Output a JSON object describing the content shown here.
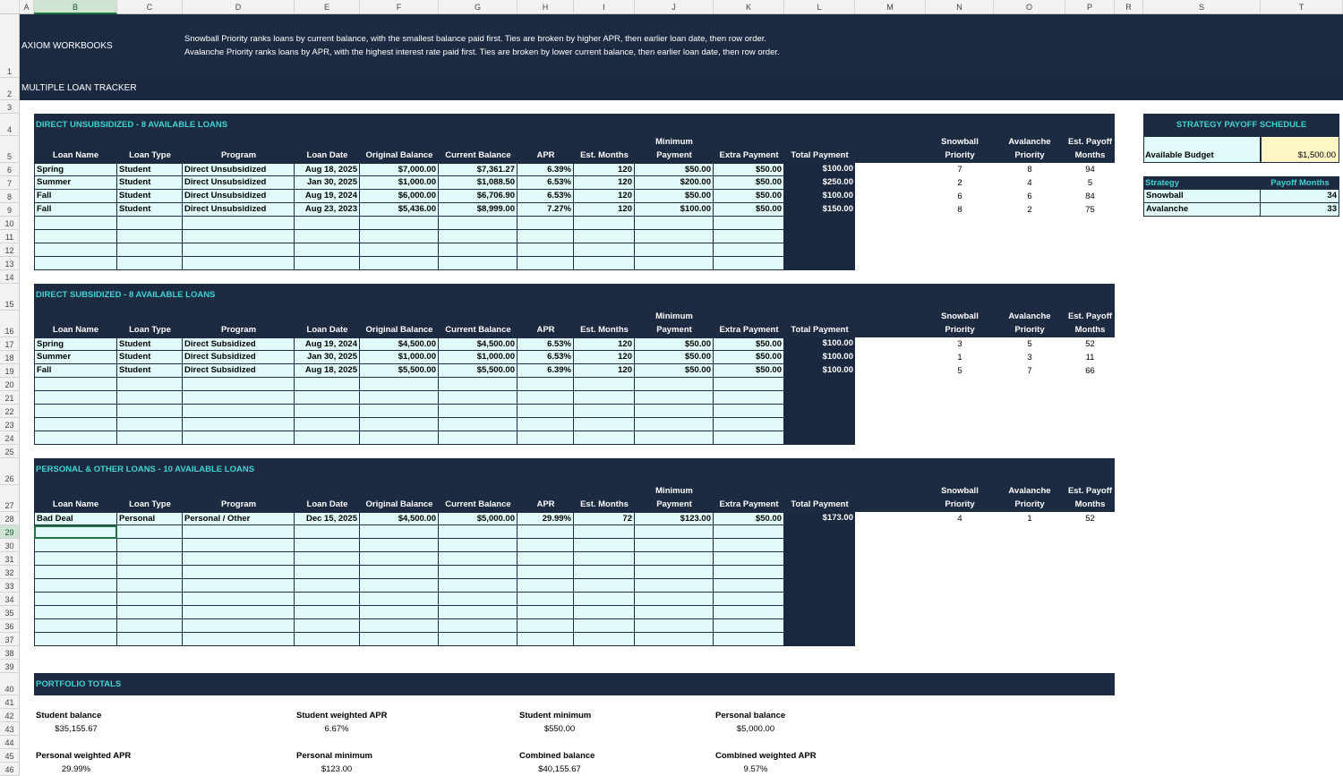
{
  "columns": [
    "A",
    "B",
    "C",
    "D",
    "E",
    "F",
    "G",
    "H",
    "I",
    "J",
    "K",
    "L",
    "M",
    "N",
    "O",
    "P",
    "R",
    "S",
    "T"
  ],
  "rows": [
    "1",
    "2",
    "3",
    "4",
    "5",
    "6",
    "7",
    "8",
    "9",
    "10",
    "11",
    "12",
    "13",
    "14",
    "15",
    "16",
    "17",
    "18",
    "19",
    "20",
    "21",
    "22",
    "23",
    "24",
    "25",
    "26",
    "27",
    "28",
    "29",
    "30",
    "31",
    "32",
    "33",
    "34",
    "35",
    "36",
    "37",
    "38",
    "39",
    "40",
    "41",
    "42",
    "43",
    "44",
    "45",
    "46"
  ],
  "header": {
    "brand": "AXIOM WORKBOOKS",
    "note1": "Snowball Priority ranks loans by current balance, with the smallest balance paid first. Ties are broken by higher APR, then earlier loan date, then row order.",
    "note2": "Avalanche Priority ranks loans by APR, with the highest interest rate paid first. Ties are broken by lower current balance, then earlier loan date, then row order.",
    "title": "MULTIPLE LOAN TRACKER"
  },
  "table_headers": {
    "loan_name": "Loan Name",
    "loan_type": "Loan Type",
    "program": "Program",
    "loan_date": "Loan Date",
    "original_balance": "Original Balance",
    "current_balance": "Current Balance",
    "apr": "APR",
    "est_months": "Est. Months",
    "min_payment_1": "Minimum",
    "min_payment_2": "Payment",
    "extra_payment": "Extra Payment",
    "total_payment": "Total Payment",
    "snowball_1": "Snowball",
    "snowball_2": "Priority",
    "avalanche_1": "Avalanche",
    "avalanche_2": "Priority",
    "payoff_1": "Est. Payoff",
    "payoff_2": "Months"
  },
  "sections": [
    {
      "title": "DIRECT UNSUBSIDIZED - 8 AVAILABLE LOANS",
      "rows": [
        {
          "name": "Spring",
          "type": "Student",
          "program": "Direct Unsubsidized",
          "date": "Aug 18, 2025",
          "orig": "$7,000.00",
          "curr": "$7,361.27",
          "apr": "6.39%",
          "months": "120",
          "min": "$50.00",
          "extra": "$50.00",
          "total": "$100.00",
          "snow": "7",
          "aval": "8",
          "payoff": "94"
        },
        {
          "name": "Summer",
          "type": "Student",
          "program": "Direct Unsubsidized",
          "date": "Jan 30, 2025",
          "orig": "$1,000.00",
          "curr": "$1,088.50",
          "apr": "6.53%",
          "months": "120",
          "min": "$200.00",
          "extra": "$50.00",
          "total": "$250.00",
          "snow": "2",
          "aval": "4",
          "payoff": "5"
        },
        {
          "name": "Fall",
          "type": "Student",
          "program": "Direct Unsubsidized",
          "date": "Aug 19, 2024",
          "orig": "$6,000.00",
          "curr": "$6,706.90",
          "apr": "6.53%",
          "months": "120",
          "min": "$50.00",
          "extra": "$50.00",
          "total": "$100.00",
          "snow": "6",
          "aval": "6",
          "payoff": "84"
        },
        {
          "name": "Fall",
          "type": "Student",
          "program": "Direct Unsubsidized",
          "date": "Aug 23, 2023",
          "orig": "$5,436.00",
          "curr": "$8,999.00",
          "apr": "7.27%",
          "months": "120",
          "min": "$100.00",
          "extra": "$50.00",
          "total": "$150.00",
          "snow": "8",
          "aval": "2",
          "payoff": "75"
        }
      ]
    },
    {
      "title": "DIRECT SUBSIDIZED - 8 AVAILABLE LOANS",
      "rows": [
        {
          "name": "Spring",
          "type": "Student",
          "program": "Direct Subsidized",
          "date": "Aug 19, 2024",
          "orig": "$4,500.00",
          "curr": "$4,500.00",
          "apr": "6.53%",
          "months": "120",
          "min": "$50.00",
          "extra": "$50.00",
          "total": "$100.00",
          "snow": "3",
          "aval": "5",
          "payoff": "52"
        },
        {
          "name": "Summer",
          "type": "Student",
          "program": "Direct Subsidized",
          "date": "Jan 30, 2025",
          "orig": "$1,000.00",
          "curr": "$1,000.00",
          "apr": "6.53%",
          "months": "120",
          "min": "$50.00",
          "extra": "$50.00",
          "total": "$100.00",
          "snow": "1",
          "aval": "3",
          "payoff": "11"
        },
        {
          "name": "Fall",
          "type": "Student",
          "program": "Direct Subsidized",
          "date": "Aug 18, 2025",
          "orig": "$5,500.00",
          "curr": "$5,500.00",
          "apr": "6.39%",
          "months": "120",
          "min": "$50.00",
          "extra": "$50.00",
          "total": "$100.00",
          "snow": "5",
          "aval": "7",
          "payoff": "66"
        }
      ]
    },
    {
      "title": "PERSONAL & OTHER LOANS - 10 AVAILABLE LOANS",
      "rows": [
        {
          "name": "Bad Deal",
          "type": "Personal",
          "program": "Personal / Other",
          "date": "Dec 15, 2025",
          "orig": "$4,500.00",
          "curr": "$5,000.00",
          "apr": "29.99%",
          "months": "72",
          "min": "$123.00",
          "extra": "$50.00",
          "total": "$173.00",
          "snow": "4",
          "aval": "1",
          "payoff": "52"
        }
      ]
    }
  ],
  "strategy": {
    "title": "STRATEGY PAYOFF SCHEDULE",
    "budget_label": "Available Budget",
    "budget_value": "$1,500.00",
    "col_strategy": "Strategy",
    "col_months": "Payoff Months",
    "rows": [
      {
        "name": "Snowball",
        "months": "34"
      },
      {
        "name": "Avalanche",
        "months": "33"
      }
    ]
  },
  "portfolio": {
    "title": "PORTFOLIO TOTALS",
    "items": [
      {
        "label": "Student balance",
        "value": "$35,155.67"
      },
      {
        "label": "Student weighted APR",
        "value": "6.67%"
      },
      {
        "label": "Student minimum",
        "value": "$550.00"
      },
      {
        "label": "Personal balance",
        "value": "$5,000.00"
      },
      {
        "label": "Personal weighted APR",
        "value": "29.99%"
      },
      {
        "label": "Personal minimum",
        "value": "$123.00"
      },
      {
        "label": "Combined balance",
        "value": "$40,155.67"
      },
      {
        "label": "Combined weighted APR",
        "value": "9.57%"
      }
    ]
  },
  "colors": {
    "navy": "#1c2a42",
    "cell_fill": "#e0fafa",
    "teal_text": "#3fd3d0",
    "budget_fill": "#fdf5c4"
  }
}
